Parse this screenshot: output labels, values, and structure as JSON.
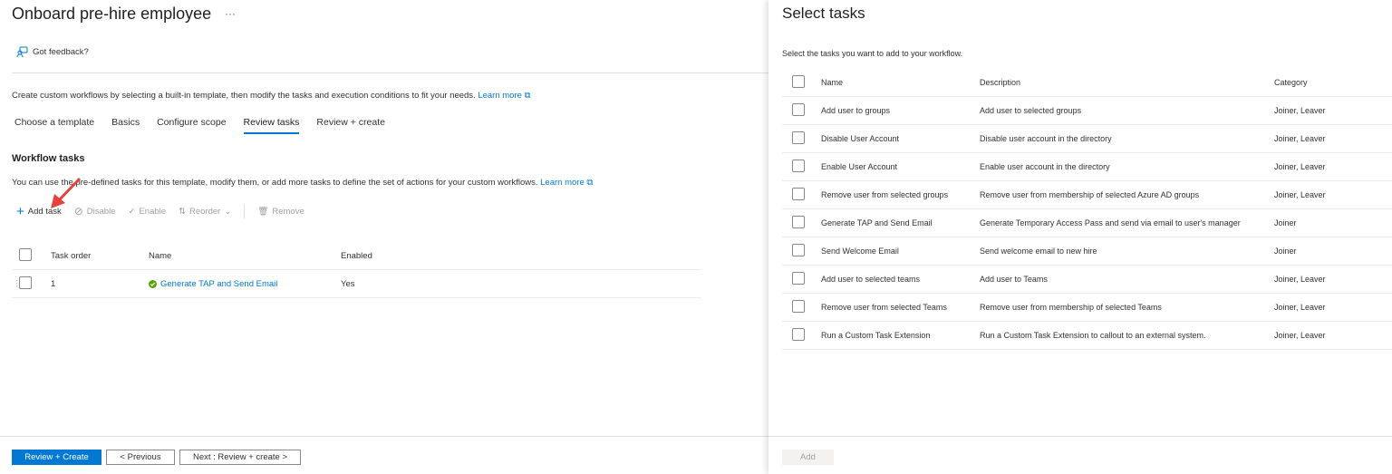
{
  "header": {
    "title": "Onboard pre-hire employee",
    "more": "···",
    "feedback": "Got feedback?"
  },
  "intro": {
    "text": "Create custom workflows by selecting a built-in template, then modify the tasks and execution conditions to fit your needs.",
    "learn_more": "Learn more"
  },
  "tabs": [
    {
      "label": "Choose a template"
    },
    {
      "label": "Basics"
    },
    {
      "label": "Configure scope"
    },
    {
      "label": "Review tasks",
      "active": true
    },
    {
      "label": "Review + create"
    }
  ],
  "workflow": {
    "heading": "Workflow tasks",
    "description": "You can use the pre-defined tasks for this template, modify them, or add more tasks to define the set of actions for your custom workflows.",
    "learn_more": "Learn more"
  },
  "toolbar": {
    "add": "Add task",
    "disable": "Disable",
    "enable": "Enable",
    "reorder": "Reorder",
    "remove": "Remove"
  },
  "task_table": {
    "columns": [
      "Task order",
      "Name",
      "Enabled"
    ],
    "rows": [
      {
        "order": "1",
        "name": "Generate TAP and Send Email",
        "enabled": "Yes",
        "status_color": "#57a300"
      }
    ]
  },
  "footer": {
    "review_create": "Review + Create",
    "previous": "< Previous",
    "next": "Next : Review + create >"
  },
  "panel": {
    "title": "Select tasks",
    "subtitle": "Select the tasks you want to add to your workflow.",
    "columns": [
      "Name",
      "Description",
      "Category"
    ],
    "rows": [
      {
        "name": "Add user to groups",
        "description": "Add user to selected groups",
        "category": "Joiner, Leaver"
      },
      {
        "name": "Disable User Account",
        "description": "Disable user account in the directory",
        "category": "Joiner, Leaver"
      },
      {
        "name": "Enable User Account",
        "description": "Enable user account in the directory",
        "category": "Joiner, Leaver"
      },
      {
        "name": "Remove user from selected groups",
        "description": "Remove user from membership of selected Azure AD groups",
        "category": "Joiner, Leaver"
      },
      {
        "name": "Generate TAP and Send Email",
        "description": "Generate Temporary Access Pass and send via email to user's manager",
        "category": "Joiner"
      },
      {
        "name": "Send Welcome Email",
        "description": "Send welcome email to new hire",
        "category": "Joiner"
      },
      {
        "name": "Add user to selected teams",
        "description": "Add user to Teams",
        "category": "Joiner, Leaver"
      },
      {
        "name": "Remove user from selected Teams",
        "description": "Remove user from membership of selected Teams",
        "category": "Joiner, Leaver"
      },
      {
        "name": "Run a Custom Task Extension",
        "description": "Run a Custom Task Extension to callout to an external system.",
        "category": "Joiner, Leaver"
      }
    ],
    "add": "Add"
  },
  "colors": {
    "accent": "#0078d4",
    "annotation_arrow": "#e8413a"
  }
}
